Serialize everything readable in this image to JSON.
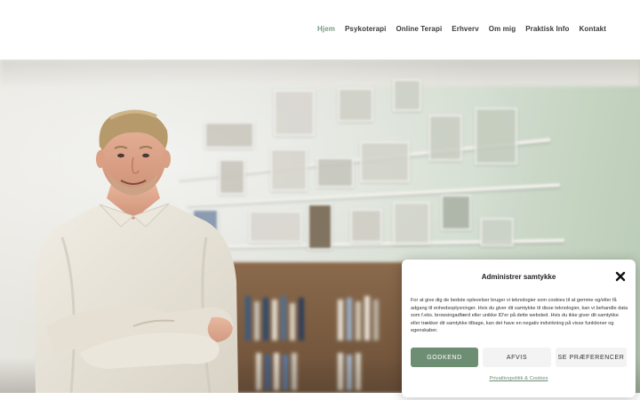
{
  "nav": {
    "items": [
      {
        "label": "Hjem",
        "active": true
      },
      {
        "label": "Psykoterapi",
        "active": false
      },
      {
        "label": "Online Terapi",
        "active": false
      },
      {
        "label": "Erhverv",
        "active": false
      },
      {
        "label": "Om mig",
        "active": false
      },
      {
        "label": "Praktisk Info",
        "active": false
      },
      {
        "label": "Kontakt",
        "active": false
      }
    ]
  },
  "colors": {
    "accent": "#7a9a80",
    "accept_button": "#6e8e74"
  },
  "cookie": {
    "title": "Administrer samtykke",
    "body": "For at give dig de bedste oplevelser bruger vi teknologier som cookies til at gemme og/eller få adgang til enhedsoplysninger. Hvis du giver dit samtykke til disse teknologier, kan vi behandle data som f.eks. browsingadfærd eller unikke ID'er på dette websted. Hvis du ikke giver dit samtykke eller trækker dit samtykke tilbage, kan det have en negativ indvirkning på visse funktioner og egenskaber.",
    "accept_label": "GODKEND",
    "deny_label": "AFVIS",
    "prefs_label": "SE PRÆFERENCER",
    "policy_link": "Privatlivspolitik & Cookies",
    "close_icon": "close-icon"
  }
}
